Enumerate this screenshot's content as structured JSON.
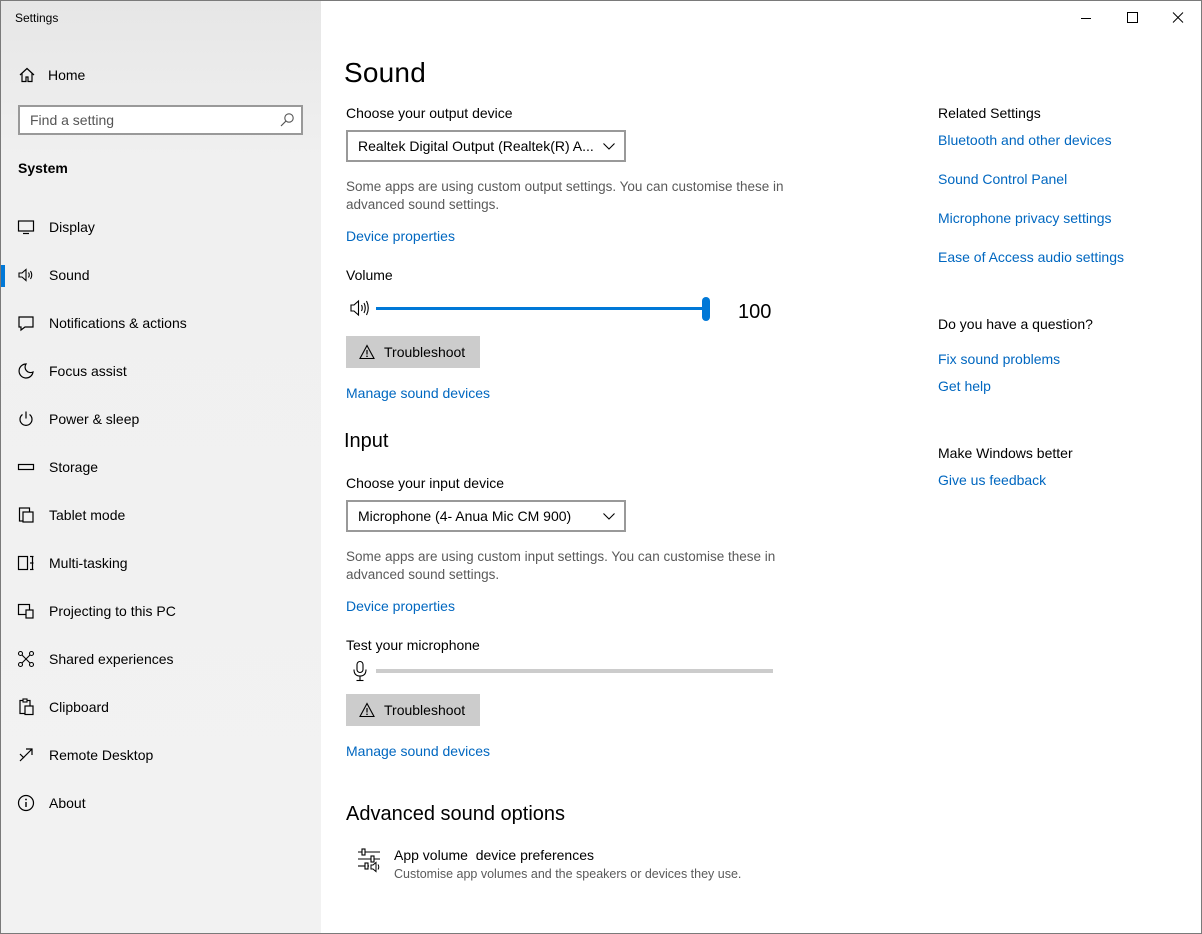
{
  "window": {
    "app_title": "Settings",
    "controls": [
      "minimize-icon",
      "maximize-icon",
      "close-icon"
    ]
  },
  "sidebar": {
    "home_label": "Home",
    "search_placeholder": "Find a setting",
    "section_label": "System",
    "items": [
      {
        "label": "Display",
        "icon": "display-icon"
      },
      {
        "label": "Sound",
        "icon": "speaker-icon",
        "active": true
      },
      {
        "label": "Notifications & actions",
        "icon": "notifications-icon"
      },
      {
        "label": "Focus assist",
        "icon": "moon-icon"
      },
      {
        "label": "Power & sleep",
        "icon": "power-icon"
      },
      {
        "label": "Storage",
        "icon": "storage-icon"
      },
      {
        "label": "Tablet mode",
        "icon": "tablet-icon"
      },
      {
        "label": "Multi-tasking",
        "icon": "multitasking-icon"
      },
      {
        "label": "Projecting to this PC",
        "icon": "projecting-icon"
      },
      {
        "label": "Shared experiences",
        "icon": "shared-icon"
      },
      {
        "label": "Clipboard",
        "icon": "clipboard-icon"
      },
      {
        "label": "Remote Desktop",
        "icon": "remote-desktop-icon"
      },
      {
        "label": "About",
        "icon": "info-icon"
      }
    ]
  },
  "main": {
    "title": "Sound",
    "output": {
      "choose_label": "Choose your output device",
      "device": "Realtek Digital Output (Realtek(R) A...",
      "description": "Some apps are using custom output settings. You can customise these in advanced sound settings.",
      "device_properties": "Device properties",
      "volume_label": "Volume",
      "volume_value": "100",
      "volume_level": 1.0,
      "troubleshoot": "Troubleshoot",
      "manage": "Manage sound devices"
    },
    "input": {
      "heading": "Input",
      "choose_label": "Choose your input device",
      "device": "Microphone (4- Anua Mic CM 900)",
      "description": "Some apps are using custom input settings. You can customise these in advanced sound settings.",
      "device_properties": "Device properties",
      "test_label": "Test your microphone",
      "mic_level": 0.0,
      "troubleshoot": "Troubleshoot",
      "manage": "Manage sound devices"
    },
    "advanced": {
      "heading": "Advanced sound options",
      "app_volume_title": "App volume  device preferences",
      "app_volume_desc": "Customise app volumes and the speakers or devices they use."
    }
  },
  "related": {
    "title": "Related Settings",
    "links": [
      "Bluetooth and other devices",
      "Sound Control Panel",
      "Microphone privacy settings",
      "Ease of Access audio settings"
    ],
    "question_title": "Do you have a question?",
    "question_links": [
      "Fix sound problems",
      "Get help"
    ],
    "better_title": "Make Windows better",
    "better_link": "Give us feedback"
  },
  "colors": {
    "accent": "#0078d7",
    "link": "#0067c0",
    "button": "#cccccc"
  }
}
